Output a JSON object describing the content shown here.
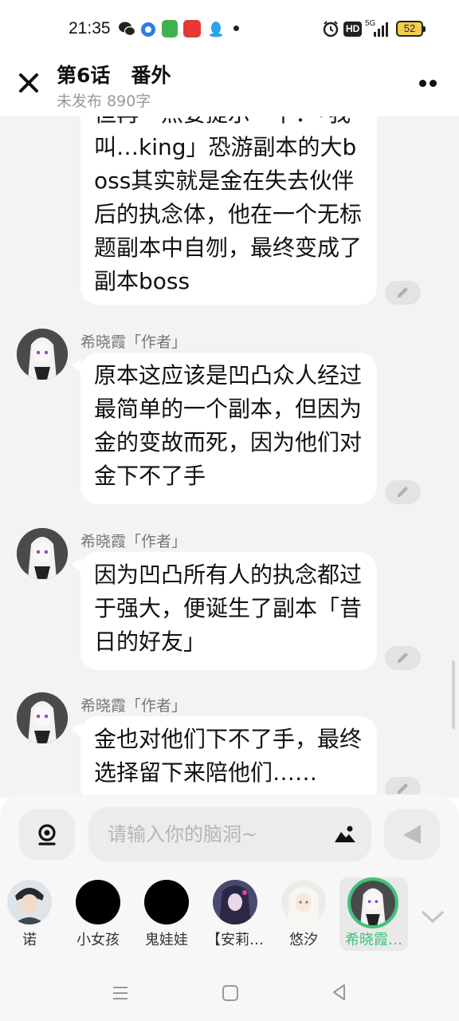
{
  "status_bar": {
    "time": "21:35",
    "hd": "HD",
    "network": "5G",
    "battery": "52",
    "icons": [
      "wechat-icon",
      "circle-app-icon",
      "green-app-icon",
      "red-app-icon",
      "qq-icon",
      "alarm-icon",
      "signal-icon"
    ]
  },
  "header": {
    "title": "第6话   番外",
    "subtitle": "未发布 890字",
    "close_icon": "close-icon",
    "more_icon": "more-icon"
  },
  "messages": [
    {
      "sender": "",
      "text": "但再一点要提示一下：「我叫…king」恐游副本的大boss其实就是金在失去伙伴后的执念体，他在一个无标题副本中自刎，最终变成了副本boss"
    },
    {
      "sender": "希晓霞「作者」",
      "text": "原本这应该是凹凸众人经过最简单的一个副本，但因为金的变故而死，因为他们对金下不了手"
    },
    {
      "sender": "希晓霞「作者」",
      "text": "因为凹凸所有人的执念都过于强大，便诞生了副本「昔日的好友」"
    },
    {
      "sender": "希晓霞「作者」",
      "text": "金也对他们下不了手，最终选择留下来陪他们……"
    }
  ],
  "input": {
    "placeholder": "请输入你的脑洞~",
    "value": ""
  },
  "characters": [
    {
      "name": "诺",
      "color": "#6b7d8c"
    },
    {
      "name": "小女孩",
      "color": "#000000"
    },
    {
      "name": "鬼娃娃",
      "color": "#000000"
    },
    {
      "name": "【安莉…",
      "color": "#4a4a6e"
    },
    {
      "name": "悠汐",
      "color": "#e8e4e0"
    },
    {
      "name": "希晓霞…",
      "color": "#3a3a3a",
      "selected": true
    }
  ],
  "colors": {
    "accent": "#3ec37a",
    "chat_background": "#f3f3f3",
    "bubble": "#ffffff"
  }
}
